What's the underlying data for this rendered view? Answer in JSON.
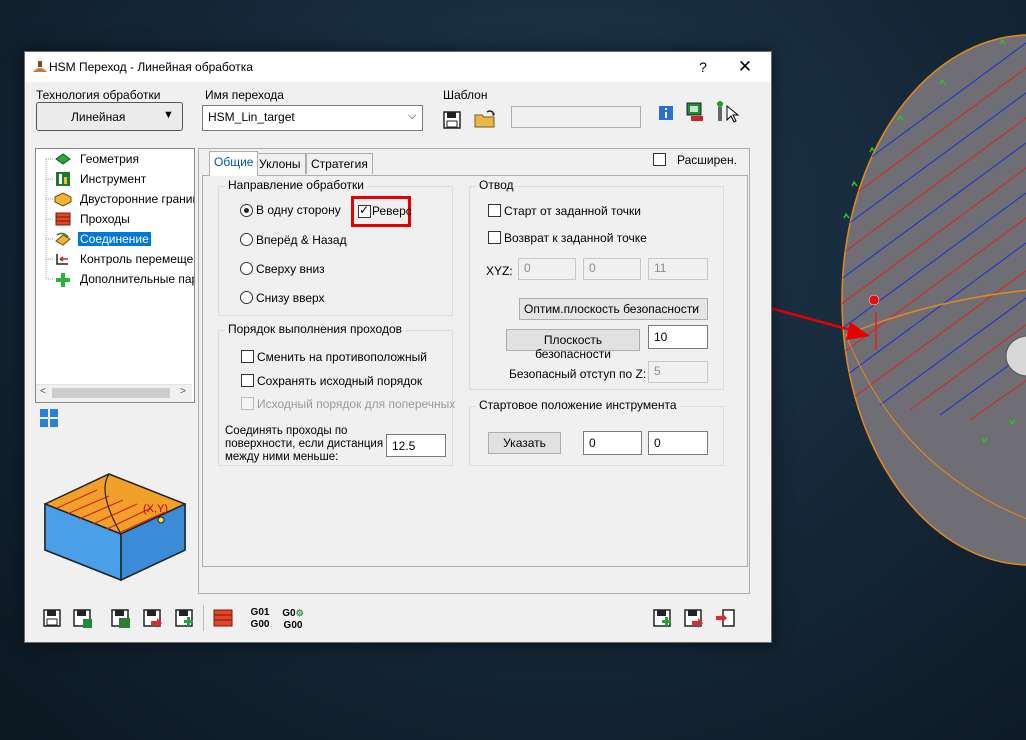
{
  "window": {
    "title": "HSM Переход - Линейная обработка",
    "help": "?",
    "close": "✕"
  },
  "technology": {
    "label": "Технология обработки",
    "value": "Линейная"
  },
  "step_name": {
    "label": "Имя перехода",
    "value": "HSM_Lin_target"
  },
  "template": {
    "label": "Шаблон",
    "value": ""
  },
  "tree": {
    "items": [
      {
        "label": "Геометрия",
        "icon": "geometry-icon"
      },
      {
        "label": "Инструмент",
        "icon": "tool-icon"
      },
      {
        "label": "Двусторонние границы",
        "icon": "boundaries-icon"
      },
      {
        "label": "Проходы",
        "icon": "passes-icon"
      },
      {
        "label": "Соединение",
        "icon": "link-icon",
        "selected": true
      },
      {
        "label": "Контроль перемещений",
        "icon": "motion-control-icon"
      },
      {
        "label": "Дополнительные параметры",
        "icon": "extra-params-icon"
      }
    ]
  },
  "preview": {
    "point_label": "(X,Y)"
  },
  "tabs": [
    {
      "label": "Общие",
      "active": true
    },
    {
      "label": "Уклоны"
    },
    {
      "label": "Стратегия"
    }
  ],
  "expanded": {
    "label": "Расширен.",
    "checked": false
  },
  "direction": {
    "title": "Направление обработки",
    "options": [
      {
        "label": "В одну сторону",
        "selected": true
      },
      {
        "label": "Вперёд & Назад",
        "selected": false
      },
      {
        "label": "Сверху вниз",
        "selected": false
      },
      {
        "label": "Снизу вверх",
        "selected": false
      }
    ],
    "reverse": {
      "label": "Реверс",
      "checked": true
    }
  },
  "order": {
    "title": "Порядок выполнения проходов",
    "options": [
      {
        "label": "Сменить на противоположный",
        "checked": false,
        "enabled": true
      },
      {
        "label": "Сохранять исходный порядок",
        "checked": false,
        "enabled": true
      },
      {
        "label": "Исходный порядок для поперечных",
        "checked": false,
        "enabled": false
      }
    ],
    "connect_label_1": "Соединять проходы по",
    "connect_label_2": "поверхности, если дистанция",
    "connect_label_3": "между ними меньше:",
    "connect_value": "12.5"
  },
  "retract": {
    "title": "Отвод",
    "start_from_point": {
      "label": "Старт от заданной точки",
      "checked": false
    },
    "return_to_point": {
      "label": "Возврат к заданной точке",
      "checked": false
    },
    "xyz_label": "XYZ:",
    "xyz": [
      "0",
      "0",
      "11"
    ],
    "safety_mode": "Оптим.плоскость безопасности",
    "safety_plane_button": "Плоскость безопасности",
    "safety_plane_value": "10",
    "safety_offset_label": "Безопасный отступ по Z:",
    "safety_offset_value": "5"
  },
  "start_position": {
    "title": "Стартовое положение инструмента",
    "button": "Указать",
    "x": "0",
    "y": "0"
  },
  "bottom_toolbar": {
    "gcode_top_1": "G01",
    "gcode_bottom_1": "G00",
    "gcode_top_2": "G0",
    "gcode_bottom_2": "G00"
  },
  "colors": {
    "background": "#16293a",
    "model_surface": "#6e6e74",
    "toolpath_blue": "#1a2fd6",
    "toolpath_red": "#e02020",
    "boundary_orange": "#e7891e",
    "arrow_red": "#e60000",
    "selection_blue": "#0078d7"
  }
}
